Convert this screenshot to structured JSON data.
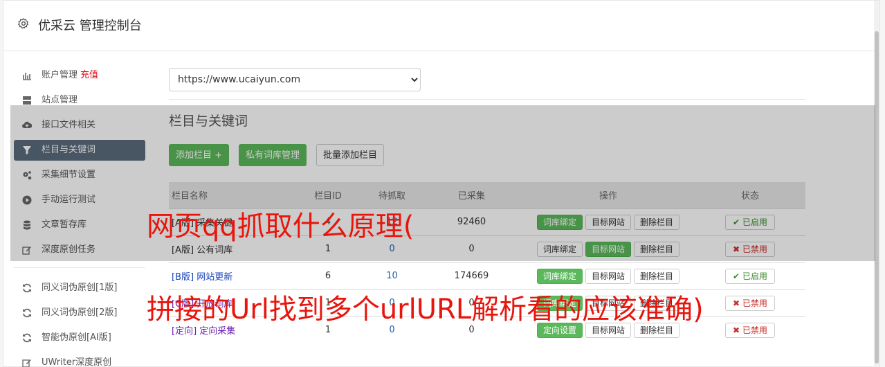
{
  "header": {
    "title": "优采云 管理控制台"
  },
  "sidebar": {
    "items": [
      {
        "label": "账户管理",
        "extra": "充值",
        "icon": "bar-chart-icon"
      },
      {
        "label": "站点管理",
        "icon": "server-icon"
      },
      {
        "label": "接口文件相关",
        "icon": "cloud-upload-icon"
      },
      {
        "label": "栏目与关键词",
        "icon": "filter-icon",
        "active": true
      },
      {
        "label": "采集细节设置",
        "icon": "cogs-icon"
      },
      {
        "label": "手动运行测试",
        "icon": "play-icon"
      },
      {
        "label": "文章暂存库",
        "icon": "database-icon"
      },
      {
        "label": "深度原创任务",
        "icon": "edit-icon"
      }
    ],
    "items2": [
      {
        "label": "同义词伪原创[1版]",
        "icon": "refresh-icon"
      },
      {
        "label": "同义词伪原创[2版]",
        "icon": "refresh-icon"
      },
      {
        "label": "智能伪原创[AI版]",
        "icon": "refresh-icon"
      },
      {
        "label": "UWriter深度原创",
        "icon": "edit-icon"
      }
    ]
  },
  "site_select": {
    "value": "https://www.ucaiyun.com"
  },
  "section": {
    "title": "栏目与关键词",
    "add_button": "添加栏目 +",
    "private_lib_button": "私有词库管理",
    "batch_add_button": "批量添加栏目"
  },
  "table": {
    "headers": {
      "name": "栏目名称",
      "id": "栏目ID",
      "pending": "待抓取",
      "collected": "已采集",
      "ops": "操作",
      "status": "状态"
    },
    "rows": [
      {
        "tag": "[A版]",
        "name": "采集关键",
        "id": "4",
        "pending": "12",
        "collected": "92460",
        "op1": "词库绑定",
        "op1_green": true,
        "op2": "目标网站",
        "op2_green": false,
        "op3": "删除栏目",
        "status": "已启用",
        "status_on": true,
        "style": "plain"
      },
      {
        "tag": "[A版]",
        "name": "公有词库",
        "id": "1",
        "pending": "0",
        "collected": "0",
        "op1": "词库绑定",
        "op1_green": false,
        "op2": "目标网站",
        "op2_green": true,
        "op3": "删除栏目",
        "status": "已禁用",
        "status_on": false,
        "style": "plain"
      },
      {
        "tag": "[B版]",
        "name": "网站更新",
        "id": "6",
        "pending": "10",
        "collected": "174669",
        "op1": "词库绑定",
        "op1_green": true,
        "op2": "目标网站",
        "op2_green": false,
        "op3": "删除栏目",
        "status": "已启用",
        "status_on": true,
        "style": "blue"
      },
      {
        "tag": "[C版]",
        "name": "开放词库",
        "id": "1",
        "pending": "0",
        "collected": "0",
        "op1": "词库绑定",
        "op1_green": true,
        "op2": "目标网站",
        "op2_green": false,
        "op3": "删除栏目",
        "status": "已禁用",
        "status_on": false,
        "style": "purple"
      },
      {
        "tag": "[定向]",
        "name": "定向采集",
        "id": "1",
        "pending": "0",
        "collected": "0",
        "op1": "定向设置",
        "op1_green": true,
        "op2": "目标网站",
        "op2_green": false,
        "op3": "删除栏目",
        "status": "已禁用",
        "status_on": false,
        "style": "purple"
      }
    ]
  },
  "watermark": {
    "line1": "网页qq抓取什么原理(",
    "line2": "拼接的Url找到多个urlURL解析看的应该准确)"
  },
  "colors": {
    "green": "#5cb85c",
    "active_nav": "#5a6b7c",
    "danger": "#c9302c",
    "watermark": "#e8150c"
  }
}
